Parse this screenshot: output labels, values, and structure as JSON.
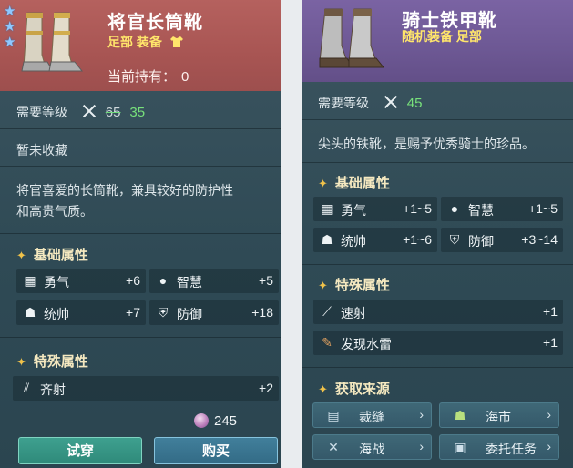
{
  "left_card": {
    "name": "将官长筒靴",
    "tags": "足部 装备",
    "owned_label": "当前持有：",
    "owned_value": "0",
    "star_count": 3,
    "level_label": "需要等级",
    "level_old": "65",
    "level_new": "35",
    "collect_status": "暂未收藏",
    "description_line1": "将官喜爱的长筒靴，兼具较好的防护性",
    "description_line2": "和高贵气质。",
    "basic_title": "基础属性",
    "basic_stats": [
      {
        "icon": "courage-icon",
        "name": "勇气",
        "value": "+6"
      },
      {
        "icon": "wisdom-icon",
        "name": "智慧",
        "value": "+5"
      },
      {
        "icon": "command-icon",
        "name": "统帅",
        "value": "+7"
      },
      {
        "icon": "defense-icon",
        "name": "防御",
        "value": "+18"
      }
    ],
    "special_title": "特殊属性",
    "special_stats": [
      {
        "icon": "volley-icon",
        "name": "齐射",
        "value": "+2"
      }
    ],
    "price": "245",
    "try_label": "试穿",
    "buy_label": "购买",
    "colors": {
      "header": "#a85553",
      "tags": "#ffe66b",
      "level_new": "#77e07b"
    }
  },
  "right_card": {
    "name": "骑士铁甲靴",
    "tags": "随机装备 足部",
    "level_label": "需要等级",
    "level_value": "45",
    "description": "尖头的铁靴，是赐予优秀骑士的珍品。",
    "basic_title": "基础属性",
    "basic_stats": [
      {
        "icon": "courage-icon",
        "name": "勇气",
        "value": "+1~5"
      },
      {
        "icon": "wisdom-icon",
        "name": "智慧",
        "value": "+1~5"
      },
      {
        "icon": "command-icon",
        "name": "统帅",
        "value": "+1~6"
      },
      {
        "icon": "defense-icon",
        "name": "防御",
        "value": "+3~14"
      }
    ],
    "special_title": "特殊属性",
    "special_stats": [
      {
        "icon": "rapid-fire-icon",
        "name": "速射",
        "value": "+1"
      },
      {
        "icon": "mine-detect-icon",
        "name": "发现水雷",
        "value": "+1"
      }
    ],
    "source_title": "获取来源",
    "sources": [
      {
        "icon": "tailor-icon",
        "label": "裁缝"
      },
      {
        "icon": "market-icon",
        "label": "海市"
      },
      {
        "icon": "naval-battle-icon",
        "label": "海战"
      },
      {
        "icon": "commission-icon",
        "label": "委托任务"
      }
    ],
    "colors": {
      "header": "#6d5894",
      "level_value": "#77e07b"
    }
  }
}
